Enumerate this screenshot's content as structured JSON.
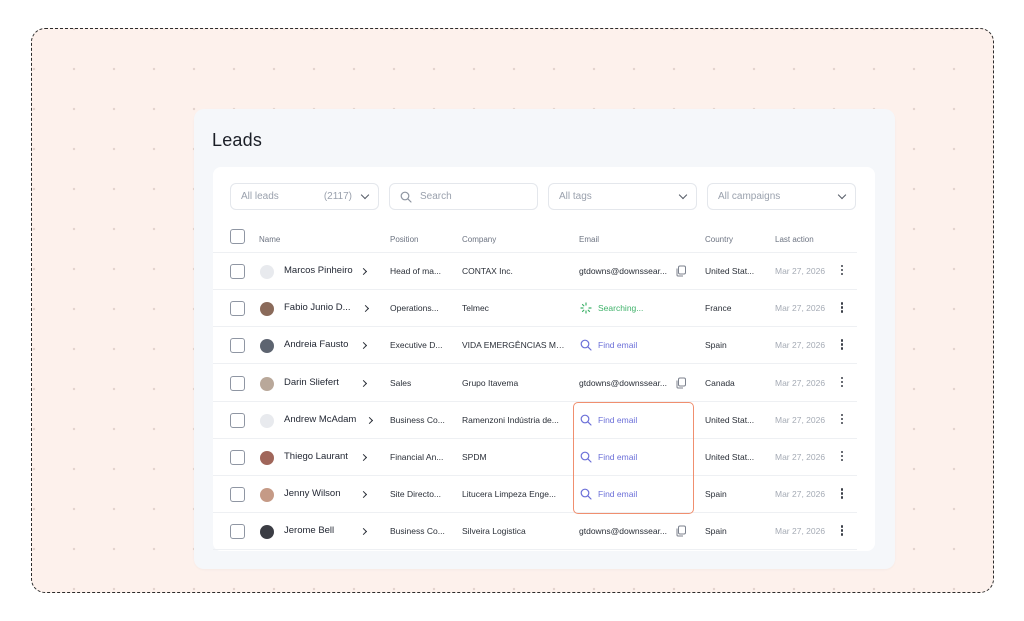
{
  "page": {
    "title": "Leads"
  },
  "filters": {
    "leads_label": "All leads",
    "leads_count": "(2117)",
    "search_placeholder": "Search",
    "tags_label": "All tags",
    "campaigns_label": "All campaigns"
  },
  "table": {
    "columns": [
      "Name",
      "Position",
      "Company",
      "Email",
      "Country",
      "Last action"
    ],
    "rows": [
      {
        "name": "Marcos Pinheiro",
        "position": "Head of ma...",
        "company": "CONTAX Inc.",
        "email": "gtdowns@downssear...",
        "email_state": "found",
        "country": "United Stat...",
        "last_action": "Mar 27, 2026",
        "avatar_color": "#e8eaee"
      },
      {
        "name": "Fabio Junio D...",
        "position": "Operations...",
        "company": "Telmec",
        "email": "Searching...",
        "email_state": "searching",
        "country": "France",
        "last_action": "Mar 27, 2026",
        "avatar_color": "#8a6a5a"
      },
      {
        "name": "Andreia Fausto",
        "position": "Executive D...",
        "company": "VIDA EMERGÊNCIAS MÉ...",
        "email": "Find email",
        "email_state": "find",
        "country": "Spain",
        "last_action": "Mar 27, 2026",
        "avatar_color": "#5d6470"
      },
      {
        "name": "Darin Sliefert",
        "position": "Sales",
        "company": "Grupo Itavema",
        "email": "gtdowns@downssear...",
        "email_state": "found",
        "country": "Canada",
        "last_action": "Mar 27, 2026",
        "avatar_color": "#b9a89a"
      },
      {
        "name": "Andrew McAdam",
        "position": "Business Co...",
        "company": "Ramenzoni Indústria de...",
        "email": "Find email",
        "email_state": "find",
        "country": "United Stat...",
        "last_action": "Mar 27, 2026",
        "avatar_color": "#e8eaee"
      },
      {
        "name": "Thiego Laurant",
        "position": "Financial An...",
        "company": "SPDM",
        "email": "Find email",
        "email_state": "find",
        "country": "United Stat...",
        "last_action": "Mar 27, 2026",
        "avatar_color": "#a0665a"
      },
      {
        "name": "Jenny Wilson",
        "position": "Site Directo...",
        "company": "Litucera Limpeza Enge...",
        "email": "Find email",
        "email_state": "find",
        "country": "Spain",
        "last_action": "Mar 27, 2026",
        "avatar_color": "#c59a86"
      },
      {
        "name": "Jerome Bell",
        "position": "Business Co...",
        "company": "Silveira Logistica",
        "email": "gtdowns@downssear...",
        "email_state": "found",
        "country": "Spain",
        "last_action": "Mar 27, 2026",
        "avatar_color": "#3b3d44"
      }
    ]
  },
  "colors": {
    "accent": "#6b6fd8",
    "success": "#3fb26a",
    "highlight": "#f08f6f",
    "background": "#fdf1ec"
  },
  "icons": {
    "search": "search-icon",
    "chevron": "chevron-down-icon",
    "copy": "copy-icon",
    "more": "kebab-menu-icon",
    "spinner": "loading-spinner-icon"
  }
}
